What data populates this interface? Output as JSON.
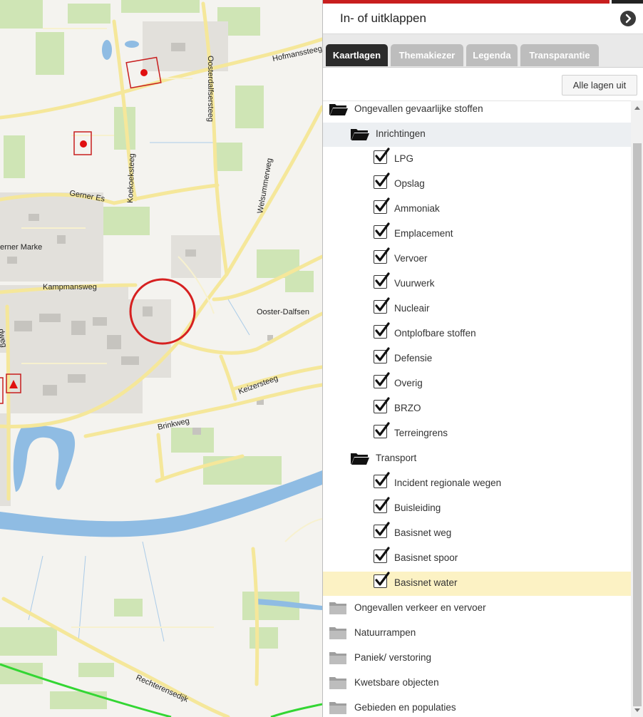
{
  "map": {
    "streets": {
      "hofmanssteeg": "Hofmanssteeg",
      "oosterdalfsersteeg": "Oosterdalfsersteeg",
      "koekoeksteeg": "Koekoeksteeg",
      "gerner_es": "Gerner Es",
      "welsummerweg": "Welsummerweg",
      "gerner_marke": "erner Marke",
      "kampmansweg": "Kampmansweg",
      "ooster_dalfsen": "Ooster-Dalfsen",
      "kwedweg": "dweg",
      "keizersteeg": "Keizersteeg",
      "brinkweg": "Brinkweg",
      "rechterensedijk": "Rechterensedijk"
    },
    "colors": {
      "land": "#f4f3ef",
      "green": "#cfe5b5",
      "water": "#8fbce3",
      "road": "#f5e79a",
      "marker": "#c81e1e",
      "highlight_circle": "#d62020",
      "boundary": "#33d633"
    }
  },
  "panel": {
    "header_title": "In- of uitklappen",
    "collapse_icon": "chevron-right-circle-icon",
    "tabs": [
      "Kaartlagen",
      "Themakiezer",
      "Legenda",
      "Transparantie"
    ],
    "active_tab": "Kaartlagen",
    "all_layers_off_label": "Alle lagen uit",
    "tree": {
      "group_open": "Ongevallen gevaarlijke stoffen",
      "inrichtingen": {
        "label": "Inrichtingen",
        "items": [
          "LPG",
          "Opslag",
          "Ammoniak",
          "Emplacement",
          "Vervoer",
          "Vuurwerk",
          "Nucleair",
          "Ontplofbare stoffen",
          "Defensie",
          "Overig",
          "BRZO",
          "Terreingrens"
        ]
      },
      "transport": {
        "label": "Transport",
        "items": [
          "Incident regionale wegen",
          "Buisleiding",
          "Basisnet weg",
          "Basisnet spoor",
          "Basisnet water"
        ]
      },
      "closed_groups": [
        "Ongevallen verkeer en vervoer",
        "Natuurrampen",
        "Paniek/ verstoring",
        "Kwetsbare objecten",
        "Gebieden en populaties"
      ]
    }
  }
}
